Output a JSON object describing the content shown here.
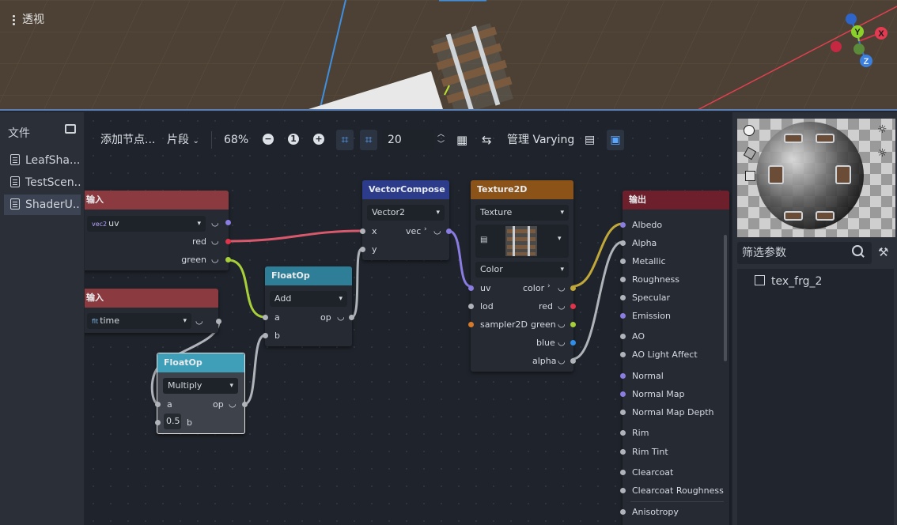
{
  "viewport": {
    "title": "透视",
    "gizmo": {
      "x": "X",
      "y": "Y",
      "z": "Z"
    }
  },
  "filesystem": {
    "label": "文件",
    "items": [
      "LeafSha...",
      "TestScen...",
      "ShaderU..."
    ],
    "selected_index": 2
  },
  "toolbar": {
    "add_node": "添加节点...",
    "mode": "片段",
    "zoom": "68%",
    "zoom_reset": "1",
    "snap_distance": "20",
    "manage_varying": "管理 Varying"
  },
  "nodes": {
    "input_uv": {
      "title": "输入",
      "value": "uv",
      "type_tag": "vec2",
      "ports": [
        "red",
        "green"
      ]
    },
    "input_time": {
      "title": "输入",
      "value": "time",
      "type_tag": "flt"
    },
    "floatop_add": {
      "title": "FloatOp",
      "op": "Add",
      "in_a": "a",
      "in_b": "b",
      "out": "op"
    },
    "floatop_mul": {
      "title": "FloatOp",
      "op": "Multiply",
      "in_a": "a",
      "in_b": "b",
      "out": "op",
      "b_value": "0.5"
    },
    "vector_compose": {
      "title": "VectorCompose",
      "type": "Vector2",
      "in_x": "x",
      "in_y": "y",
      "out": "vec"
    },
    "texture2d": {
      "title": "Texture2D",
      "source": "Texture",
      "type": "Color",
      "inputs": [
        "uv",
        "lod",
        "sampler2D"
      ],
      "outputs": [
        "color",
        "red",
        "green",
        "blue",
        "alpha"
      ]
    },
    "output": {
      "title": "输出",
      "ports": [
        "Albedo",
        "Alpha",
        "Metallic",
        "Roughness",
        "Specular",
        "Emission",
        "AO",
        "AO Light Affect",
        "Normal",
        "Normal Map",
        "Normal Map Depth",
        "Rim",
        "Rim Tint",
        "Clearcoat",
        "Clearcoat Roughness",
        "Anisotropy"
      ]
    }
  },
  "colors": {
    "input_header": "#8b3a3f",
    "floatop_header": "#2f7e97",
    "vector_header": "#2c3c8b",
    "texture_header": "#8b5318",
    "output_header": "#6e1f2c"
  },
  "parameters": {
    "filter_placeholder": "筛选参数",
    "items": [
      "tex_frg_2"
    ]
  }
}
